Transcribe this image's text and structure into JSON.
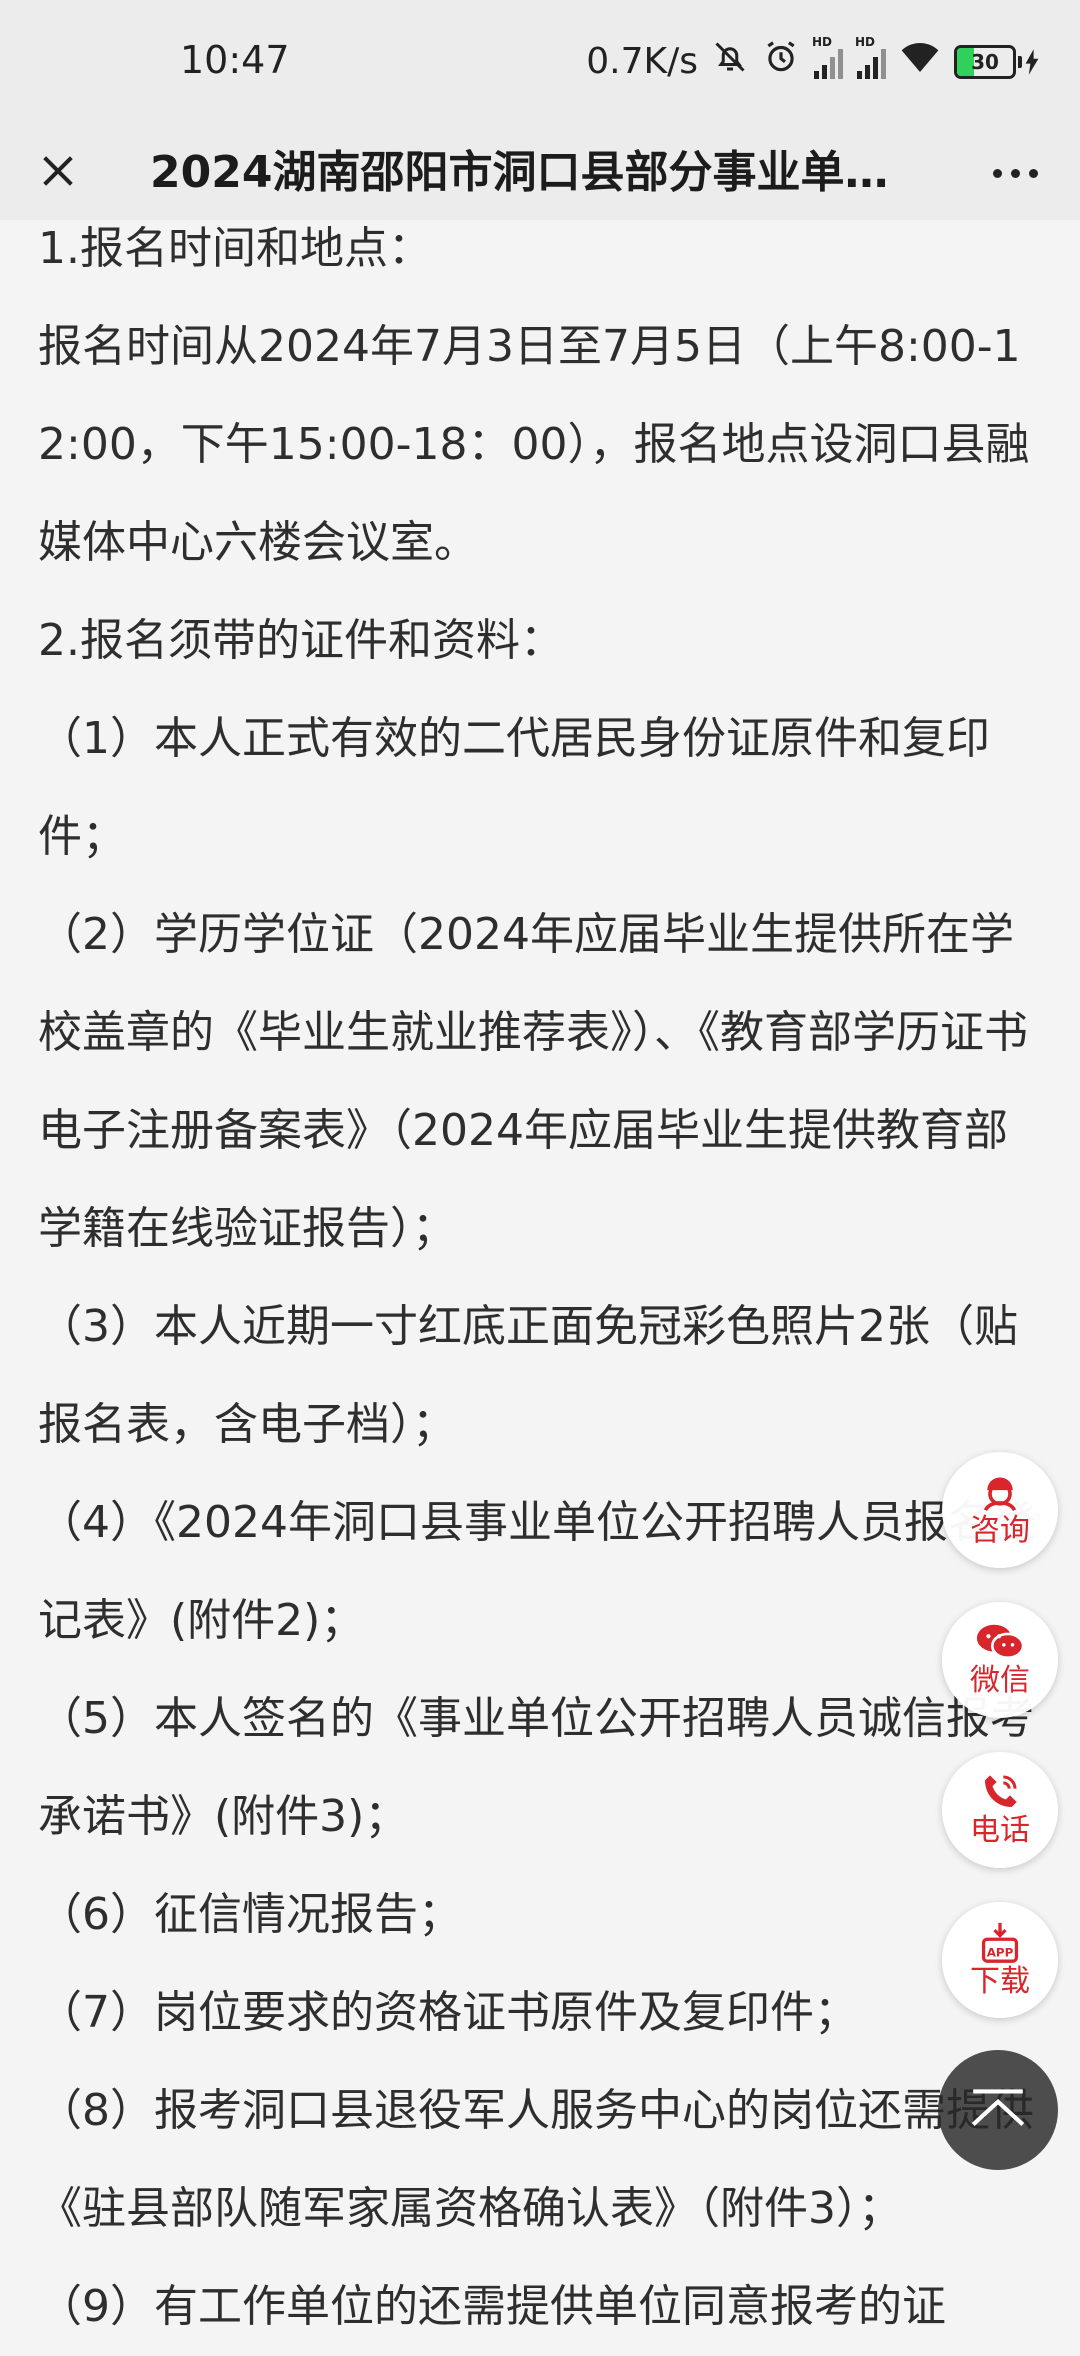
{
  "status_bar": {
    "time": "10:47",
    "net_speed": "0.7K/s",
    "battery_level": "30",
    "battery_fraction": 0.3
  },
  "header": {
    "title": "2024湖南邵阳市洞口县部分事业单…"
  },
  "article": {
    "paragraphs": [
      "1.报名时间和地点：",
      "报名时间从2024年7月3日至7月5日（上午8:00-12:00，下午15:00-18：00），报名地点设洞口县融媒体中心六楼会议室。",
      "2.报名须带的证件和资料：",
      "（1）本人正式有效的二代居民身份证原件和复印件；",
      "（2）学历学位证（2024年应届毕业生提供所在学校盖章的《毕业生就业推荐表》）、《教育部学历证书电子注册备案表》（2024年应届毕业生提供教育部学籍在线验证报告）；",
      "（3）本人近期一寸红底正面免冠彩色照片2张（贴报名表，含电子档）；",
      "（4）《2024年洞口县事业单位公开招聘人员报名登记表》(附件2)；",
      "（5）本人签名的《事业单位公开招聘人员诚信报考承诺书》(附件3)；",
      "（6）征信情况报告；",
      "（7）岗位要求的资格证书原件及复印件；",
      "（8）报考洞口县退役军人服务中心的岗位还需提供《驻县部队随军家属资格确认表》（附件3）；",
      "（9）有工作单位的还需提供单位同意报考的证"
    ]
  },
  "float_buttons": {
    "consult": "咨询",
    "wechat": "微信",
    "phone": "电话",
    "download": "下载",
    "app_badge": "APP"
  },
  "icons": {
    "close": "close-icon",
    "more": "more-icon",
    "mute": "bell-off-icon",
    "alarm": "alarm-icon",
    "signal": "signal-icon",
    "wifi": "wifi-icon",
    "battery": "battery-icon",
    "back_to_top": "back-to-top-icon"
  },
  "colors": {
    "accent": "#d8262c",
    "background": "#f4f4f4",
    "text": "#2e2e2e"
  }
}
